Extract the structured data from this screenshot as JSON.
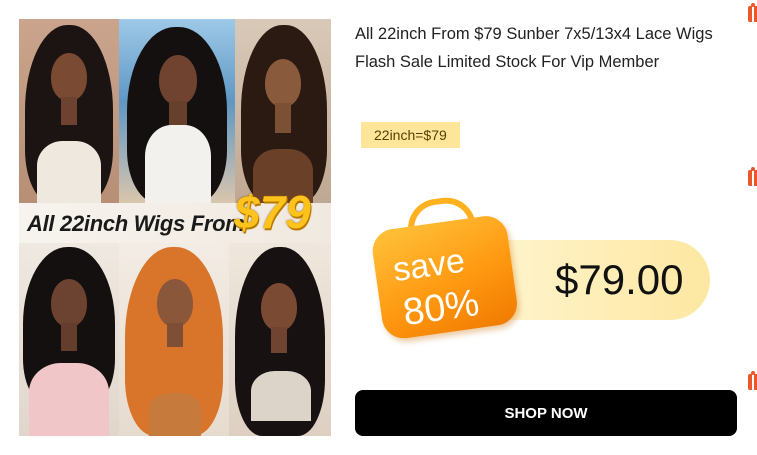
{
  "product": {
    "title": "All 22inch From $79 Sunber 7x5/13x4 Lace Wigs Flash Sale Limited Stock For Vip Member",
    "price_tag": "22inch=$79",
    "image_banner": {
      "text": "All 22inch Wigs From",
      "price": "$79"
    },
    "sale_badge": {
      "line1": "save",
      "line2": "80%"
    },
    "sale_price": "$79.00",
    "cta_label": "SHOP NOW"
  },
  "colors": {
    "button_bg": "#000000",
    "tag_bg": "#fde59a",
    "badge_orange": "#ff9a12",
    "banner_price_gold": "#ffc21a",
    "side_icon": "#e8582a"
  },
  "side_icons": [
    "gift-icon",
    "gift-icon",
    "gift-icon"
  ]
}
